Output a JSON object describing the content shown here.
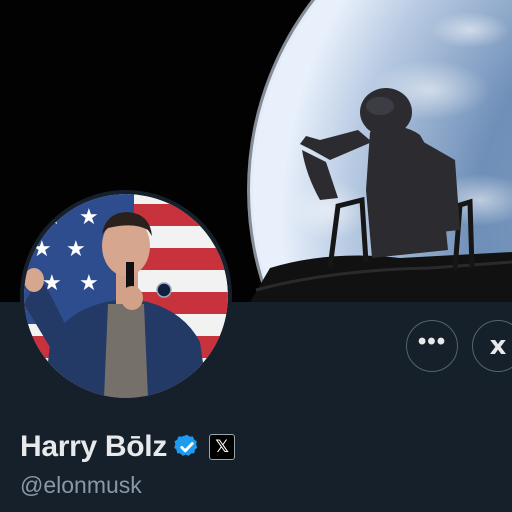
{
  "profile": {
    "display_name": "Harry Bōlz",
    "handle": "@elonmusk",
    "verified": true,
    "affiliation_badge_text": "𝕏"
  },
  "actions": {
    "more_label": "•••",
    "xai_label": "x"
  },
  "colors": {
    "background": "#15202b",
    "text_primary": "#e7e9ea",
    "text_secondary": "#8b98a5",
    "verified_blue": "#1d9bf0",
    "button_border": "#536471"
  },
  "icons": {
    "verified": "verified-check-icon",
    "affiliation": "x-logo-icon",
    "more": "more-dots-icon",
    "xai": "xai-logo-icon"
  }
}
